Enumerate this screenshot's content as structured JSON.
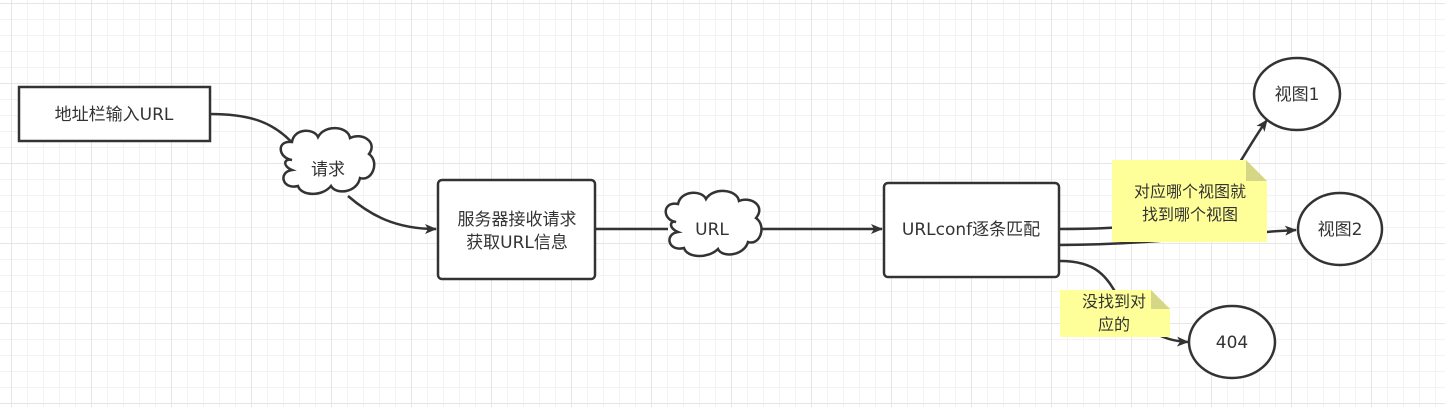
{
  "nodes": {
    "address_bar": "地址栏输入URL",
    "request_cloud": "请求",
    "server_box_line1": "服务器接收请求",
    "server_box_line2": "获取URL信息",
    "url_cloud": "URL",
    "urlconf_box": "URLconf逐条匹配",
    "view1": "视图1",
    "view2": "视图2",
    "not_found": "404"
  },
  "notes": {
    "match_line1": "对应哪个视图就",
    "match_line2": "找到哪个视图",
    "nomatch_line1": "没找到对",
    "nomatch_line2": "应的"
  }
}
